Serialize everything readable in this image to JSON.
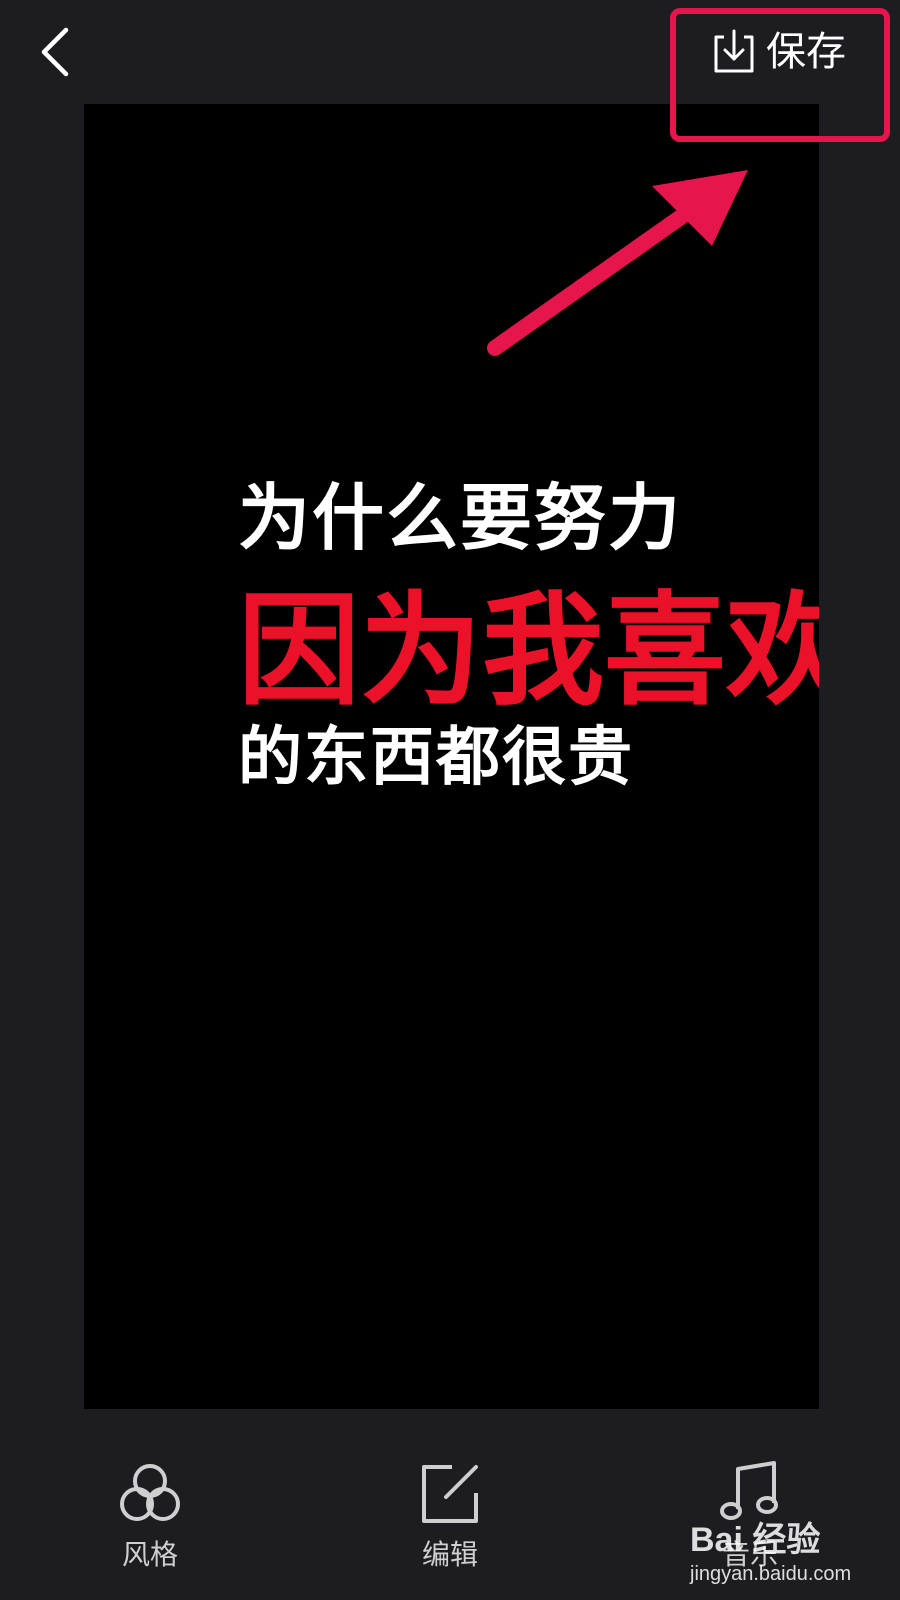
{
  "header": {
    "back_icon": "chevron-left-icon",
    "save_icon": "download-icon",
    "save_label": "保存"
  },
  "preview": {
    "line_1": "为什么要努力",
    "line_2": "因为我喜欢",
    "line_3": "的东西都很贵"
  },
  "toolbar": {
    "items": [
      {
        "icon": "style-circles-icon",
        "label": "风格"
      },
      {
        "icon": "edit-icon",
        "label": "编辑"
      },
      {
        "icon": "music-note-icon",
        "label": "音乐"
      }
    ]
  },
  "watermark": {
    "brand": "Bai 经验",
    "url": "jingyan.baidu.com"
  },
  "colors": {
    "background": "#1d1c21",
    "preview_background": "#000000",
    "caption_red": "#ea1129",
    "annotation_red": "#e6154c"
  }
}
